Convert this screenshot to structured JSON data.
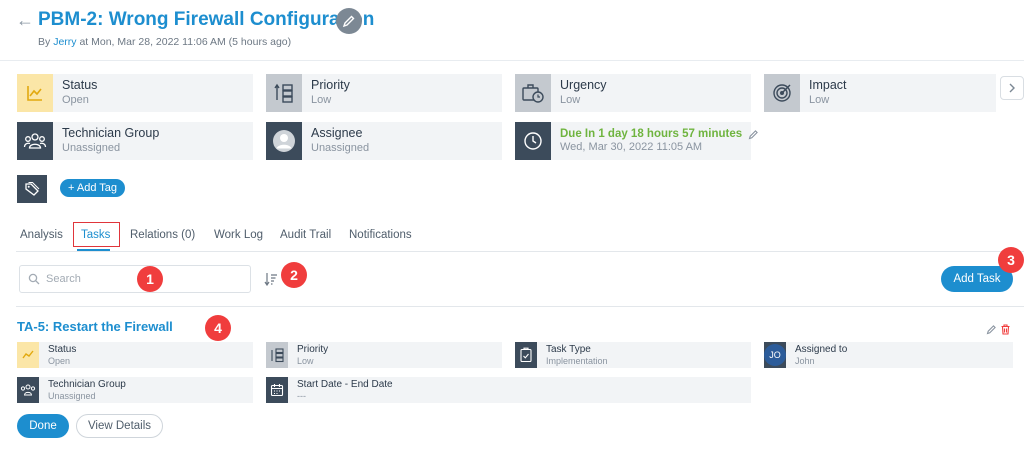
{
  "header": {
    "back_icon": "arrow-left-icon",
    "title": "PBM-2: Wrong Firewall Configuration",
    "meta_prefix": "By",
    "author": "Jerry",
    "meta_suffix": "at Mon, Mar 28, 2022 11:06 AM (5 hours ago)"
  },
  "info_cards": {
    "status": {
      "label": "Status",
      "value": "Open",
      "icon": "chart-line-icon"
    },
    "priority": {
      "label": "Priority",
      "value": "Low",
      "icon": "priority-icon"
    },
    "urgency": {
      "label": "Urgency",
      "value": "Low",
      "icon": "briefcase-clock-icon"
    },
    "impact": {
      "label": "Impact",
      "value": "Low",
      "icon": "target-icon"
    },
    "technician_group": {
      "label": "Technician Group",
      "value": "Unassigned",
      "icon": "group-icon"
    },
    "assignee": {
      "label": "Assignee",
      "value": "Unassigned",
      "icon": "user-avatar-icon"
    },
    "due": {
      "label": "Due In  1 day 18 hours 57 minutes",
      "value": "Wed, Mar 30, 2022 11:05 AM",
      "icon": "clock-icon"
    }
  },
  "tags": {
    "add_label": "+ Add Tag"
  },
  "tabs": [
    {
      "label": "Analysis",
      "active": false
    },
    {
      "label": "Tasks",
      "active": true
    },
    {
      "label": "Relations (0)",
      "active": false
    },
    {
      "label": "Work Log",
      "active": false
    },
    {
      "label": "Audit Trail",
      "active": false
    },
    {
      "label": "Notifications",
      "active": false
    }
  ],
  "toolbar": {
    "search_placeholder": "Search",
    "add_task_label": "Add Task"
  },
  "badges": [
    "1",
    "2",
    "3",
    "4"
  ],
  "task": {
    "title": "TA-5: Restart the Firewall",
    "fields": {
      "status": {
        "label": "Status",
        "value": "Open"
      },
      "priority": {
        "label": "Priority",
        "value": "Low"
      },
      "task_type": {
        "label": "Task Type",
        "value": "Implementation"
      },
      "assigned_to": {
        "label": "Assigned to",
        "value": "John",
        "initials": "JO"
      },
      "technician_group": {
        "label": "Technician Group",
        "value": "Unassigned"
      },
      "dates": {
        "label": "Start Date - End Date",
        "value": "---"
      }
    },
    "done_label": "Done",
    "view_details_label": "View Details"
  },
  "colors": {
    "accent": "#1d8ecf",
    "dark_icon_bg": "#3c4b5b",
    "status_icon_bg": "#fbe6a7",
    "due_text": "#6fb43f",
    "badge": "#f03d3d",
    "tab_highlight": "#e0353b"
  }
}
